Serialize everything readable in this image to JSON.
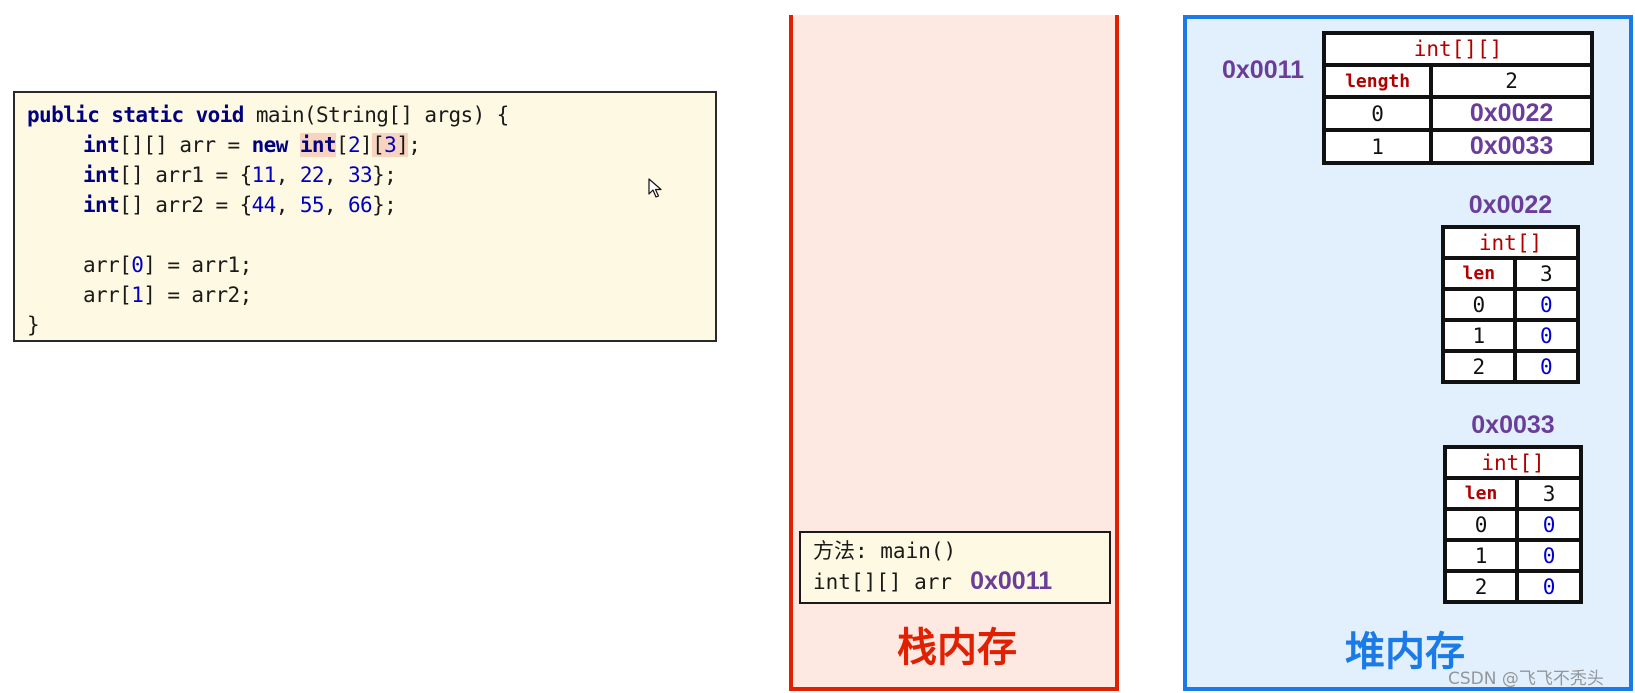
{
  "code": {
    "lines": [
      {
        "indent": 0,
        "tokens": [
          {
            "t": "public static void",
            "c": "kw"
          },
          {
            "t": " main(String[] args) {",
            "c": ""
          }
        ]
      },
      {
        "indent": 1,
        "tokens": [
          {
            "t": "int",
            "c": "kw"
          },
          {
            "t": "[][] arr = ",
            "c": ""
          },
          {
            "t": "new",
            "c": "kw"
          },
          {
            "t": " ",
            "c": ""
          },
          {
            "t": "int",
            "c": "kw hl"
          },
          {
            "t": "[",
            "c": ""
          },
          {
            "t": "2",
            "c": "num"
          },
          {
            "t": "]",
            "c": ""
          },
          {
            "t": "[",
            "c": "hl"
          },
          {
            "t": "3",
            "c": "num hl"
          },
          {
            "t": "]",
            "c": "hl"
          },
          {
            "t": ";",
            "c": ""
          }
        ]
      },
      {
        "indent": 1,
        "tokens": [
          {
            "t": "int",
            "c": "kw"
          },
          {
            "t": "[] arr1 = {",
            "c": ""
          },
          {
            "t": "11",
            "c": "num"
          },
          {
            "t": ", ",
            "c": ""
          },
          {
            "t": "22",
            "c": "num"
          },
          {
            "t": ", ",
            "c": ""
          },
          {
            "t": "33",
            "c": "num"
          },
          {
            "t": "};",
            "c": ""
          }
        ]
      },
      {
        "indent": 1,
        "tokens": [
          {
            "t": "int",
            "c": "kw"
          },
          {
            "t": "[] arr2 = {",
            "c": ""
          },
          {
            "t": "44",
            "c": "num"
          },
          {
            "t": ", ",
            "c": ""
          },
          {
            "t": "55",
            "c": "num"
          },
          {
            "t": ", ",
            "c": ""
          },
          {
            "t": "66",
            "c": "num"
          },
          {
            "t": "};",
            "c": ""
          }
        ]
      },
      {
        "indent": 0,
        "tokens": []
      },
      {
        "indent": 1,
        "tokens": [
          {
            "t": "arr[",
            "c": ""
          },
          {
            "t": "0",
            "c": "num"
          },
          {
            "t": "] = arr1;",
            "c": ""
          }
        ]
      },
      {
        "indent": 1,
        "tokens": [
          {
            "t": "arr[",
            "c": ""
          },
          {
            "t": "1",
            "c": "num"
          },
          {
            "t": "] = arr2;",
            "c": ""
          }
        ]
      },
      {
        "indent": 0,
        "tokens": [
          {
            "t": "}",
            "c": ""
          }
        ]
      }
    ]
  },
  "stack": {
    "label": "栈内存",
    "frame": {
      "method_line": "方法: main()",
      "var_decl": "int[][] arr",
      "var_value": "0x0011"
    }
  },
  "heap": {
    "label": "堆内存",
    "outer_array": {
      "address": "0x0011",
      "type": "int[][]",
      "length_label": "length",
      "length": "2",
      "rows": [
        {
          "index": "0",
          "value": "0x0022"
        },
        {
          "index": "1",
          "value": "0x0033"
        }
      ]
    },
    "arr1": {
      "address": "0x0022",
      "type": "int[]",
      "length_label": "len",
      "length": "3",
      "rows": [
        {
          "index": "0",
          "value": "0"
        },
        {
          "index": "1",
          "value": "0"
        },
        {
          "index": "2",
          "value": "0"
        }
      ]
    },
    "arr2": {
      "address": "0x0033",
      "type": "int[]",
      "length_label": "len",
      "length": "3",
      "rows": [
        {
          "index": "0",
          "value": "0"
        },
        {
          "index": "1",
          "value": "0"
        },
        {
          "index": "2",
          "value": "0"
        }
      ]
    }
  },
  "watermark": "CSDN @飞飞不秃头",
  "colors": {
    "stack_border": "#e02000",
    "heap_border": "#1a7ae8",
    "address": "#6a3d9a",
    "type_label": "#b00000"
  }
}
